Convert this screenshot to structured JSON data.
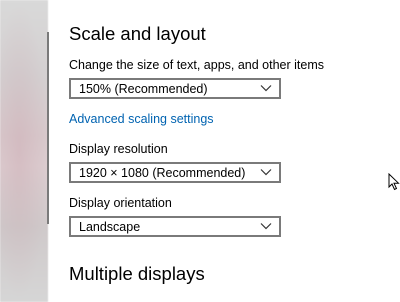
{
  "scale_section": {
    "heading": "Scale and layout",
    "scale_label": "Change the size of text, apps, and other items",
    "scale_value": "150% (Recommended)",
    "advanced_link": "Advanced scaling settings",
    "resolution_label": "Display resolution",
    "resolution_value": "1920 × 1080 (Recommended)",
    "orientation_label": "Display orientation",
    "orientation_value": "Landscape"
  },
  "multiple_displays": {
    "heading": "Multiple displays"
  },
  "colors": {
    "link": "#0063b1",
    "dropdown_border": "#7a7a7a"
  },
  "icons": {
    "dropdown": "chevron-down-icon",
    "pointer": "mouse-cursor-icon"
  }
}
